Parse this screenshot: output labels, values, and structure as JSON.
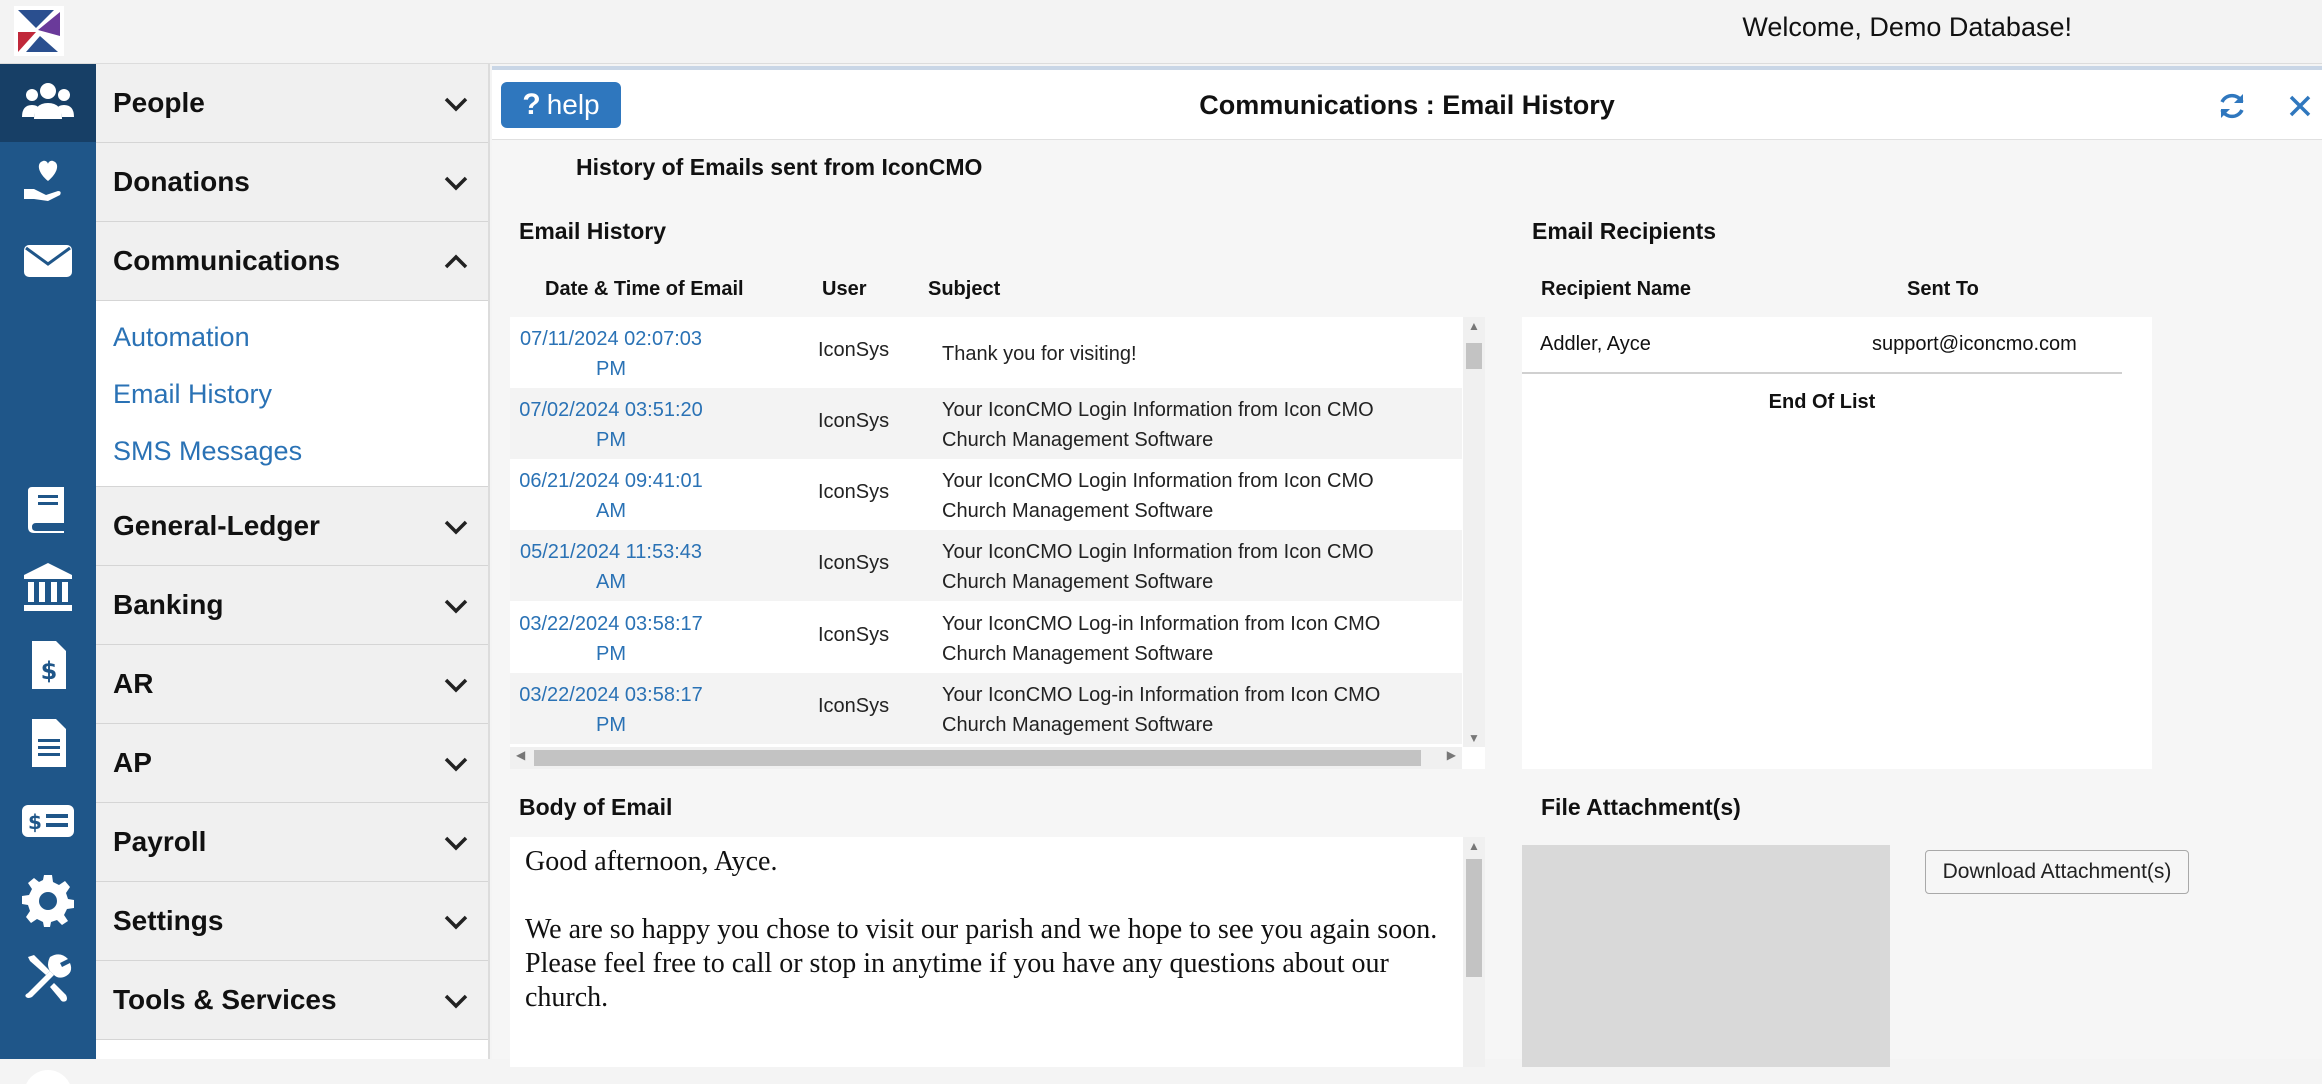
{
  "header": {
    "welcome": "Welcome, Demo Database!"
  },
  "rail": {
    "icons": [
      "people-icon",
      "donations-icon",
      "email-icon",
      "ledger-icon",
      "bank-icon",
      "invoice-icon",
      "document-icon",
      "payroll-icon",
      "settings-icon",
      "tools-icon"
    ]
  },
  "menu": {
    "people": "People",
    "donations": "Donations",
    "communications": "Communications",
    "sub": {
      "automation": "Automation",
      "email_history": "Email History",
      "sms": "SMS Messages"
    },
    "general_ledger": "General-Ledger",
    "banking": "Banking",
    "ar": "AR",
    "ap": "AP",
    "payroll": "Payroll",
    "settings": "Settings",
    "tools": "Tools & Services"
  },
  "main": {
    "help_label": "help",
    "help_mark": "?",
    "title": "Communications : Email History",
    "subtitle": "History of Emails sent from IconCMO"
  },
  "history": {
    "title": "Email History",
    "columns": {
      "datetime": "Date & Time of Email",
      "user": "User",
      "subject": "Subject"
    },
    "rows": [
      {
        "date": "07/11/2024 02:07:03",
        "ampm": "PM",
        "user": "IconSys",
        "subject": "Thank you for visiting!"
      },
      {
        "date": "07/02/2024 03:51:20",
        "ampm": "PM",
        "user": "IconSys",
        "subject": "Your IconCMO Login Information from Icon CMO Church Management Software"
      },
      {
        "date": "06/21/2024 09:41:01",
        "ampm": "AM",
        "user": "IconSys",
        "subject": "Your IconCMO Login Information from Icon CMO Church Management Software"
      },
      {
        "date": "05/21/2024 11:53:43",
        "ampm": "AM",
        "user": "IconSys",
        "subject": "Your IconCMO Login Information from Icon CMO Church Management Software"
      },
      {
        "date": "03/22/2024 03:58:17",
        "ampm": "PM",
        "user": "IconSys",
        "subject": "Your IconCMO Log-in Information from Icon CMO Church Management Software"
      },
      {
        "date": "03/22/2024 03:58:17",
        "ampm": "PM",
        "user": "IconSys",
        "subject": "Your IconCMO Log-in Information from Icon CMO Church Management Software"
      }
    ]
  },
  "recipients": {
    "title": "Email Recipients",
    "columns": {
      "name": "Recipient Name",
      "sent_to": "Sent To"
    },
    "rows": [
      {
        "name": "Addler, Ayce",
        "sent_to": "support@iconcmo.com"
      }
    ],
    "end_label": "End Of List"
  },
  "body": {
    "title": "Body of Email",
    "line1": "Good afternoon, Ayce.",
    "line2": "We are so happy you chose to visit our parish and we hope to see you again soon.",
    "line3": "Please feel free to call or stop in anytime if you have any questions about our church."
  },
  "attachments": {
    "title": "File Attachment(s)",
    "download_label": "Download Attachment(s)"
  },
  "colors": {
    "rail": "#1f5689",
    "accent": "#2f77be",
    "link": "#2a72b5"
  }
}
